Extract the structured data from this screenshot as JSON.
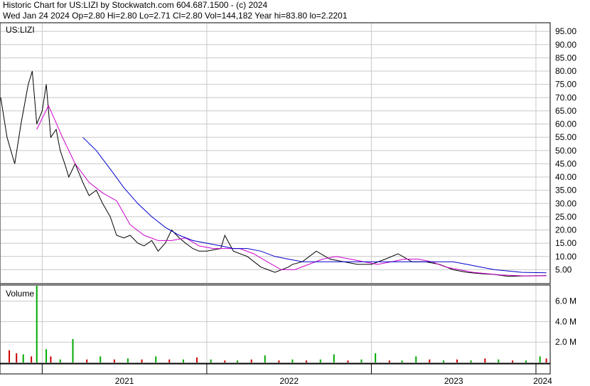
{
  "header": {
    "line1": "Historic Chart for US:LIZI by Stockwatch.com 604.687.1500 - (c) 2024",
    "line2": "Wed Jan 24 2024   Op=2.80  Hi=2.80  Lo=2.71  Cl=2.80  Vol=144,182  Year hi=83.80  lo=2.2201"
  },
  "price_panel": {
    "symbol_label": "US:LIZI"
  },
  "volume_panel": {
    "label": "Volume"
  },
  "colors": {
    "price": "#000000",
    "ma_short": "#cc00cc",
    "ma_long": "#0000cc",
    "vol_up": "#00aa00",
    "vol_down": "#cc0000",
    "grid": "#c8c8c8"
  },
  "chart_data": [
    {
      "type": "line",
      "title": "US:LIZI",
      "y_ticks": [
        "95.00",
        "90.00",
        "85.00",
        "80.00",
        "75.00",
        "70.00",
        "65.00",
        "60.00",
        "55.00",
        "50.00",
        "45.00",
        "40.00",
        "35.00",
        "30.00",
        "25.00",
        "20.00",
        "15.00",
        "10.00",
        "5.00"
      ],
      "ylim": [
        0,
        98
      ],
      "x_tick_labels": [
        "2021",
        "2022",
        "2023",
        "2024"
      ],
      "xlim": [
        "2020-10-01",
        "2024-01-31"
      ],
      "grid": true,
      "series": [
        {
          "name": "",
          "role": "price",
          "x": [
            "2020-10-01",
            "2020-10-15",
            "2020-11-01",
            "2020-11-15",
            "2020-12-01",
            "2020-12-10",
            "2020-12-20",
            "2021-01-01",
            "2021-01-10",
            "2021-01-20",
            "2021-02-01",
            "2021-02-10",
            "2021-02-20",
            "2021-03-01",
            "2021-03-15",
            "2021-04-01",
            "2021-04-15",
            "2021-05-01",
            "2021-05-15",
            "2021-06-01",
            "2021-06-15",
            "2021-07-01",
            "2021-07-15",
            "2021-08-01",
            "2021-08-15",
            "2021-09-01",
            "2021-09-15",
            "2021-10-01",
            "2021-10-15",
            "2021-11-01",
            "2021-11-15",
            "2021-12-01",
            "2021-12-15",
            "2022-01-01",
            "2022-02-01",
            "2022-02-10",
            "2022-03-01",
            "2022-04-01",
            "2022-05-01",
            "2022-06-01",
            "2022-07-01",
            "2022-07-10",
            "2022-08-01",
            "2022-09-01",
            "2022-10-01",
            "2022-11-01",
            "2022-12-01",
            "2023-01-01",
            "2023-02-01",
            "2023-03-01",
            "2023-04-01",
            "2023-05-01",
            "2023-06-01",
            "2023-07-01",
            "2023-08-01",
            "2023-09-01",
            "2023-10-01",
            "2023-11-01",
            "2023-12-01",
            "2024-01-01",
            "2024-01-24"
          ],
          "values": [
            70,
            55,
            45,
            60,
            75,
            80,
            60,
            65,
            75,
            55,
            58,
            50,
            45,
            40,
            45,
            38,
            33,
            35,
            30,
            25,
            18,
            17,
            18,
            15,
            14,
            16,
            12,
            15,
            20,
            17,
            15,
            13,
            12,
            12,
            13,
            18,
            12,
            10,
            6,
            4,
            6,
            7,
            8,
            12,
            9,
            8,
            7,
            7,
            9,
            11,
            8,
            8,
            7,
            5,
            4,
            3.5,
            3.2,
            2.5,
            2.6,
            2.7,
            2.8
          ]
        },
        {
          "name": "",
          "role": "ma_short",
          "x": [
            "2020-12-20",
            "2021-01-15",
            "2021-02-15",
            "2021-03-15",
            "2021-04-15",
            "2021-05-15",
            "2021-06-15",
            "2021-07-15",
            "2021-08-15",
            "2021-09-15",
            "2021-10-15",
            "2021-11-15",
            "2021-12-15",
            "2022-01-15",
            "2022-02-15",
            "2022-03-15",
            "2022-04-15",
            "2022-05-15",
            "2022-06-15",
            "2022-07-15",
            "2022-08-15",
            "2022-09-15",
            "2022-10-15",
            "2022-11-15",
            "2022-12-15",
            "2023-01-15",
            "2023-02-15",
            "2023-03-15",
            "2023-04-15",
            "2023-05-15",
            "2023-06-15",
            "2023-07-15",
            "2023-08-15",
            "2023-09-15",
            "2023-10-15",
            "2023-11-15",
            "2023-12-15",
            "2024-01-24"
          ],
          "values": [
            58,
            67,
            55,
            45,
            38,
            34,
            31,
            22,
            18,
            16,
            16,
            17,
            14,
            13,
            13,
            13,
            11,
            8,
            5,
            5,
            7,
            9,
            10,
            9,
            8,
            7,
            8,
            9,
            9,
            8,
            6,
            5,
            4,
            3.5,
            3,
            2.8,
            2.6,
            2.7
          ]
        },
        {
          "name": "",
          "role": "ma_long",
          "x": [
            "2021-04-01",
            "2021-05-01",
            "2021-06-01",
            "2021-07-01",
            "2021-08-01",
            "2021-09-01",
            "2021-10-01",
            "2021-11-01",
            "2021-12-01",
            "2022-01-01",
            "2022-02-01",
            "2022-03-01",
            "2022-04-01",
            "2022-05-01",
            "2022-06-01",
            "2022-07-01",
            "2022-08-01",
            "2022-09-01",
            "2022-10-01",
            "2022-11-01",
            "2022-12-01",
            "2023-01-01",
            "2023-02-01",
            "2023-03-01",
            "2023-04-01",
            "2023-05-01",
            "2023-06-01",
            "2023-07-01",
            "2023-08-01",
            "2023-09-01",
            "2023-10-01",
            "2023-11-01",
            "2023-12-01",
            "2024-01-24"
          ],
          "values": [
            55,
            50,
            43,
            36,
            30,
            25,
            21,
            18,
            16,
            15,
            14,
            13,
            13,
            12,
            10,
            9,
            8,
            8,
            8,
            8,
            8,
            8,
            8,
            8,
            8,
            8,
            8,
            8,
            7,
            6,
            5,
            4.5,
            4,
            3.8
          ]
        }
      ]
    },
    {
      "type": "bar",
      "title": "Volume",
      "y_ticks": [
        "6.0 M",
        "4.0 M",
        "2.0 M"
      ],
      "ylim": [
        0,
        7.5
      ],
      "x": [
        "2020-10-20",
        "2020-11-05",
        "2020-11-20",
        "2020-12-08",
        "2020-12-20",
        "2021-01-10",
        "2021-01-20",
        "2021-02-10",
        "2021-03-10",
        "2021-04-10",
        "2021-05-10",
        "2021-06-10",
        "2021-07-10",
        "2021-08-10",
        "2021-09-10",
        "2021-10-10",
        "2021-11-10",
        "2021-12-10",
        "2022-01-10",
        "2022-02-10",
        "2022-03-10",
        "2022-04-10",
        "2022-05-10",
        "2022-06-10",
        "2022-07-10",
        "2022-08-10",
        "2022-09-10",
        "2022-10-10",
        "2022-11-10",
        "2022-12-10",
        "2023-01-10",
        "2023-02-10",
        "2023-03-10",
        "2023-04-10",
        "2023-05-10",
        "2023-06-10",
        "2023-07-10",
        "2023-08-10",
        "2023-09-10",
        "2023-10-10",
        "2023-11-10",
        "2023-12-10",
        "2024-01-10",
        "2024-01-24"
      ],
      "values": [
        1.2,
        0.9,
        0.8,
        0.6,
        7.5,
        1.3,
        0.6,
        0.3,
        2.3,
        0.3,
        0.6,
        0.3,
        0.4,
        0.3,
        0.6,
        0.3,
        0.3,
        0.5,
        0.3,
        0.2,
        0.2,
        0.3,
        0.7,
        0.2,
        0.3,
        0.2,
        0.3,
        0.8,
        0.2,
        0.3,
        0.9,
        0.2,
        0.2,
        0.6,
        0.3,
        0.2,
        0.3,
        0.2,
        0.4,
        0.3,
        0.2,
        0.2,
        0.6,
        0.4
      ],
      "directions": [
        "down",
        "down",
        "up",
        "down",
        "up",
        "up",
        "down",
        "up",
        "up",
        "down",
        "up",
        "down",
        "up",
        "down",
        "up",
        "down",
        "up",
        "down",
        "up",
        "down",
        "up",
        "down",
        "up",
        "down",
        "up",
        "down",
        "up",
        "up",
        "down",
        "up",
        "up",
        "down",
        "up",
        "up",
        "down",
        "up",
        "down",
        "up",
        "down",
        "up",
        "down",
        "up",
        "up",
        "down"
      ]
    }
  ]
}
